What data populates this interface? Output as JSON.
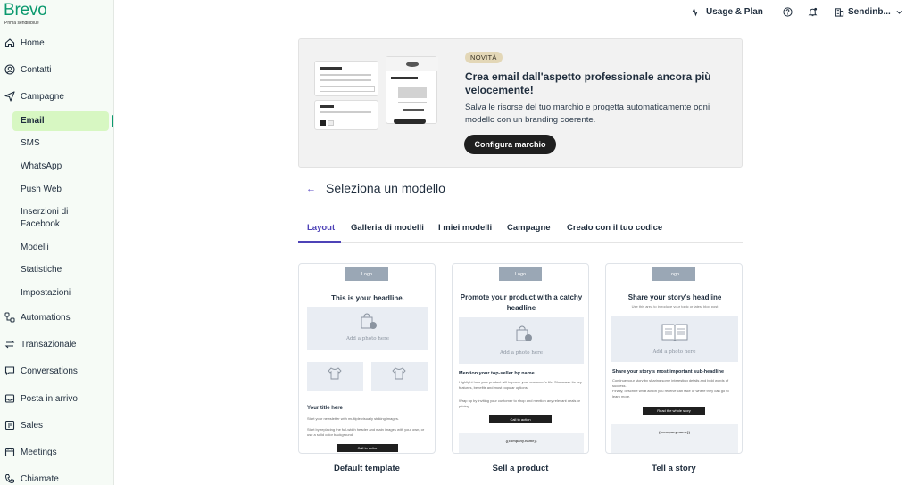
{
  "brand": {
    "name": "Brevo",
    "sub": "Prima sendinblue"
  },
  "sidebar": {
    "items": [
      {
        "label": "Home",
        "icon": "home-icon"
      },
      {
        "label": "Contatti",
        "icon": "contacts-icon"
      },
      {
        "label": "Campagne",
        "icon": "send-icon"
      },
      {
        "label": "Automations",
        "icon": "automations-icon"
      },
      {
        "label": "Transazionale",
        "icon": "transactional-icon"
      },
      {
        "label": "Conversations",
        "icon": "chat-icon"
      },
      {
        "label": "Posta in arrivo",
        "icon": "inbox-icon"
      },
      {
        "label": "Sales",
        "icon": "sales-icon"
      },
      {
        "label": "Meetings",
        "icon": "calendar-icon"
      },
      {
        "label": "Chiamate",
        "icon": "phone-icon"
      }
    ],
    "sub_items": [
      {
        "label": "Email",
        "active": true
      },
      {
        "label": "SMS"
      },
      {
        "label": "WhatsApp"
      },
      {
        "label": "Push Web"
      },
      {
        "label": "Inserzioni di Facebook"
      },
      {
        "label": "Modelli"
      },
      {
        "label": "Statistiche"
      },
      {
        "label": "Impostazioni"
      }
    ]
  },
  "topbar": {
    "usage": "Usage & Plan",
    "account": "Sendinb..."
  },
  "banner": {
    "badge": "NOVITÀ",
    "title": "Crea email dall'aspetto professionale ancora più velocemente!",
    "description": "Salva le risorse del tuo marchio e progetta automaticamente ogni modello con un branding coerente.",
    "button": "Configura marchio"
  },
  "page": {
    "title": "Seleziona un modello"
  },
  "tabs": [
    {
      "label": "Layout",
      "active": true
    },
    {
      "label": "Galleria di modelli"
    },
    {
      "label": "I miei modelli"
    },
    {
      "label": "Campagne"
    },
    {
      "label": "Crealo con il tuo codice"
    }
  ],
  "templates": [
    {
      "name": "Default template",
      "logo": "Logo",
      "headline": "This is your headline.",
      "photo_text": "Add a photo here",
      "title2": "Your title here",
      "text1": "Start your newsletter with multiple visually striking images.",
      "text2": "Start by replacing the full-width header and main images with your own, or use a solid color background.",
      "button": "Call to action"
    },
    {
      "name": "Sell a product",
      "logo": "Logo",
      "headline": "Promote your product with a catchy headline",
      "photo_text": "Add a photo here",
      "title2": "Mention your top-seller by name",
      "text1": "Highlight how your product will improve your customer's life. Showcase its key features, benefits and most popular options.",
      "text2": "Wrap up by inviting your customer to shop and mention any relevant deals or pricing.",
      "button": "Call to action",
      "footer": "{{company.name}}"
    },
    {
      "name": "Tell a story",
      "logo": "Logo",
      "headline": "Share your story's headline",
      "subheadline": "Use this area to introduce your topic or latest blog post",
      "photo_text": "Add a photo here",
      "title2": "Share your story's most important sub-headline",
      "text1": "Continue your story by sharing some interesting details and bold words of success.",
      "text2": "Finally, describe what action you receive can take or where they can go to learn more.",
      "button": "Read the whole story",
      "footer": "{{company.name}}"
    }
  ]
}
